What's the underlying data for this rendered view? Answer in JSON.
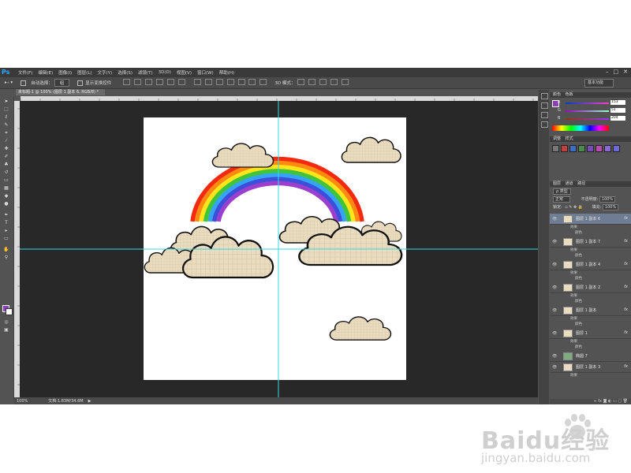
{
  "app": {
    "logo": "Ps"
  },
  "menu": [
    "文件(F)",
    "编辑(E)",
    "图像(I)",
    "图层(L)",
    "文字(Y)",
    "选择(S)",
    "滤镜(T)",
    "3D(D)",
    "视图(V)",
    "窗口(W)",
    "帮助(H)"
  ],
  "window_controls": {
    "minimize": "–",
    "maximize": "□",
    "close": "✕"
  },
  "options_bar": {
    "auto_select_label": "自动选择：",
    "auto_select_value": "组",
    "show_transform_label": "显示变换控件",
    "mode_3d_label": "3D 模式：",
    "workspace": "基本功能"
  },
  "document_tab": {
    "title": "未标题-1 @ 100% (图层 1 副本 6, RGB/8) *",
    "close": "×"
  },
  "status_bar": {
    "zoom": "100%",
    "doc_info": "文档:1.83M/34.6M",
    "arrow": "▶"
  },
  "color_panel": {
    "tabs": [
      "颜色",
      "色板"
    ],
    "fg_color": "#8e3eb8",
    "rows": [
      {
        "label": "R",
        "value": "153",
        "gradient": "linear-gradient(90deg,#003ccc,#ff3ccc)"
      },
      {
        "label": "G",
        "value": "51",
        "gradient": "linear-gradient(90deg,#9900cc,#99ffcc)"
      },
      {
        "label": "B",
        "value": "204",
        "gradient": "linear-gradient(90deg,#993300,#9933ff)"
      }
    ]
  },
  "styles_panel": {
    "tabs": [
      "调整",
      "样式"
    ],
    "swatches": [
      "#777777",
      "#c24040",
      "#3b6fc2",
      "#4a8a4a",
      "#7a4ab8",
      "#b84ab0",
      "#8a6ad0",
      "#6a6ad8"
    ]
  },
  "layers_panel": {
    "tabs": [
      "图层",
      "通道",
      "路径"
    ],
    "filter_label": "ρ 类型",
    "blend_mode": "正常",
    "opacity_label": "不透明度:",
    "opacity_value": "100%",
    "lock_label": "锁定:",
    "fill_label": "填充:",
    "fill_value": "100%",
    "layers": [
      {
        "name": "图层 1 副本 6",
        "fx": "fx",
        "sub": [
          "效果",
          "颜色"
        ]
      },
      {
        "name": "图层 1 副本 7",
        "fx": "fx",
        "sub": [
          "效果",
          "颜色"
        ]
      },
      {
        "name": "图层 1 副本 4",
        "fx": "fx",
        "sub": [
          "效果",
          "颜色"
        ]
      },
      {
        "name": "图层 1 副本 2",
        "fx": "fx",
        "sub": [
          "效果",
          "颜色"
        ]
      },
      {
        "name": "图层 1 副本",
        "fx": "fx",
        "sub": [
          "效果",
          "颜色"
        ]
      },
      {
        "name": "图层 1",
        "fx": "fx",
        "sub": [
          "效果",
          "颜色"
        ]
      },
      {
        "name": "椭圆 7",
        "fx": "",
        "sub": []
      },
      {
        "name": "图层 1 副本 3",
        "fx": "fx",
        "sub": [
          "效果"
        ]
      }
    ]
  },
  "canvas": {
    "rainbow_colors": [
      "#f42a10",
      "#ff8a12",
      "#ffe51a",
      "#3fc43a",
      "#36a4f5",
      "#3d4fd8",
      "#9b3fcf"
    ],
    "cloud_fill": "#eadcc0",
    "guide_color": "#3ad7e8"
  },
  "watermark": {
    "brand": "Baidu经验",
    "url": "jingyan.baidu.com"
  }
}
